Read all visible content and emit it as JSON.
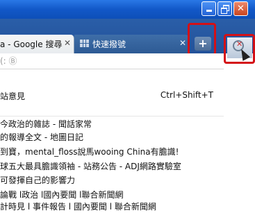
{
  "window": {
    "min_label": "_",
    "close_label": "✕"
  },
  "tabs": [
    {
      "title": "a - Google 搜尋",
      "close": "✕"
    },
    {
      "title": "快速撥號",
      "close": "✕"
    }
  ],
  "new_tab_label": "+",
  "addressbar": {
    "text": "(: Ⓑ"
  },
  "menu": {
    "items": [
      {
        "label": "站意見",
        "shortcut": "Ctrl+Shift+T"
      },
      {
        "label": "今政治的雜誌 - 聞話家常",
        "shortcut": ""
      },
      {
        "label": "的報導全文 - 地圖日記",
        "shortcut": ""
      },
      {
        "label": "到寶，mental_floss說馬wooing China有膽識!",
        "shortcut": ""
      },
      {
        "label": "球五大最具膽識領袖 - 站務公告 - ADJ網路實驗室",
        "shortcut": ""
      },
      {
        "label": "可發揮自己的影響力",
        "shortcut": ""
      },
      {
        "label": "論戰 l政治 l國內要聞 l聯合新聞網",
        "shortcut": ""
      },
      {
        "label": "計時見 l 事件報告 l 國內要聞 l 聯合新聞網",
        "shortcut": ""
      }
    ]
  },
  "colors": {
    "titlebar": "#1258c8",
    "tabstrip": "#23529a",
    "highlight": "#d41016"
  }
}
